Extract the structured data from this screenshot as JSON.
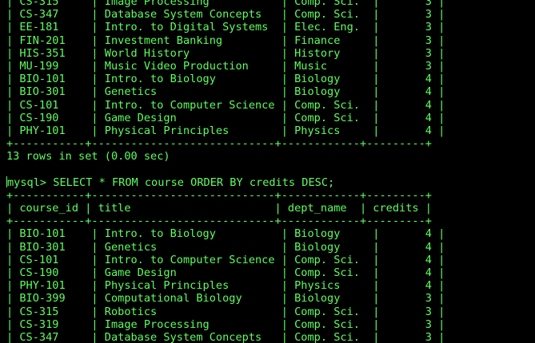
{
  "terminal": {
    "colors": {
      "background": "#000000",
      "text": "#5cff5c"
    },
    "first_result": {
      "rows": [
        "| CS-315     | Image Processing           | Comp. Sci.  |       3 |",
        "| CS-347     | Database System Concepts   | Comp. Sci.  |       3 |",
        "| EE-181     | Intro. to Digital Systems  | Elec. Eng.  |       3 |",
        "| FIN-201    | Investment Banking         | Finance     |       3 |",
        "| HIS-351    | World History              | History     |       3 |",
        "| MU-199     | Music Video Production     | Music       |       3 |",
        "| BIO-101    | Intro. to Biology          | Biology     |       4 |",
        "| BIO-301    | Genetics                   | Biology     |       4 |",
        "| CS-101     | Intro. to Computer Science | Comp. Sci.  |       4 |",
        "| CS-190     | Game Design                | Comp. Sci.  |       4 |",
        "| PHY-101    | Physical Principles        | Physics     |       4 |"
      ],
      "border": "+-----------+----------------------------+------------+---------+",
      "summary": "13 rows in set (0.00 sec)"
    },
    "prompt": "mysql> ",
    "command": "SELECT * FROM course ORDER BY credits DESC;",
    "second_result": {
      "border": "+-----------+----------------------------+------------+---------+",
      "header": "| course_id | title                      | dept_name  | credits |",
      "rows": [
        "| BIO-101    | Intro. to Biology          | Biology     |       4 |",
        "| BIO-301    | Genetics                   | Biology     |       4 |",
        "| CS-101     | Intro. to Computer Science | Comp. Sci.  |       4 |",
        "| CS-190     | Game Design                | Comp. Sci.  |       4 |",
        "| PHY-101    | Physical Principles        | Physics     |       4 |",
        "| BIO-399    | Computational Biology      | Biology     |       3 |",
        "| CS-315     | Robotics                   | Comp. Sci.  |       3 |",
        "| CS-319     | Image Processing           | Comp. Sci.  |       3 |",
        "| CS-347     | Database System Concepts   | Comp. Sci.  |       3 |"
      ]
    }
  }
}
